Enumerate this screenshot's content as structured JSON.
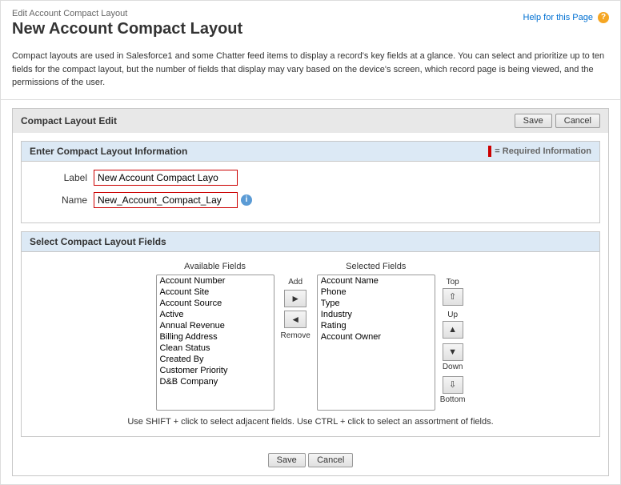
{
  "breadcrumb": "Edit Account Compact Layout",
  "page_title": "New Account Compact Layout",
  "help_link": "Help for this Page",
  "description": "Compact layouts are used in Salesforce1 and some Chatter feed items to display a record's key fields at a glance. You can select and prioritize up to ten fields for the compact layout, but the number of fields that display may vary based on the device's screen, which record page is being viewed, and the permissions of the user.",
  "compact_layout_edit": {
    "header": "Compact Layout Edit",
    "save_label": "Save",
    "cancel_label": "Cancel"
  },
  "enter_info": {
    "header": "Enter Compact Layout Information",
    "required_legend": "= Required Information",
    "label_label": "Label",
    "label_value": "New Account Compact Layo",
    "name_label": "Name",
    "name_value": "New_Account_Compact_Lay",
    "info_icon": "i"
  },
  "select_fields": {
    "header": "Select Compact Layout Fields",
    "available_label": "Available Fields",
    "selected_label": "Selected Fields",
    "add_label": "Add",
    "remove_label": "Remove",
    "available_fields": [
      "Account Number",
      "Account Site",
      "Account Source",
      "Active",
      "Annual Revenue",
      "Billing Address",
      "Clean Status",
      "Created By",
      "Customer Priority",
      "D&B Company"
    ],
    "selected_fields": [
      "Account Name",
      "Phone",
      "Type",
      "Industry",
      "Rating",
      "Account Owner"
    ],
    "top_label": "Top",
    "up_label": "Up",
    "down_label": "Down",
    "bottom_label": "Bottom",
    "hint": "Use SHIFT + click to select adjacent fields. Use CTRL + click to select an assortment of fields."
  },
  "bottom_save": "Save",
  "bottom_cancel": "Cancel"
}
